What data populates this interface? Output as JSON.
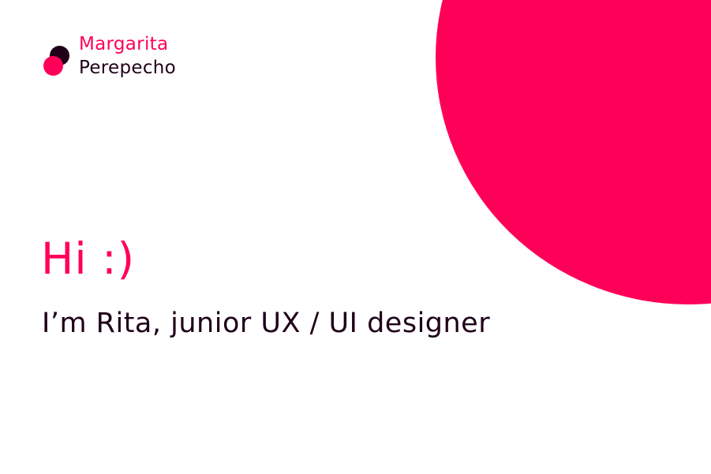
{
  "logo": {
    "first_name": "Margarita",
    "last_name": "Perepecho",
    "mark_icon": "two-overlapping-circles-icon"
  },
  "hero": {
    "greeting": "Hi :)",
    "tagline": "I’m Rita, junior UX / UI designer"
  },
  "colors": {
    "accent": "#ff0059",
    "text_dark": "#1f0018",
    "background": "#ffffff"
  }
}
